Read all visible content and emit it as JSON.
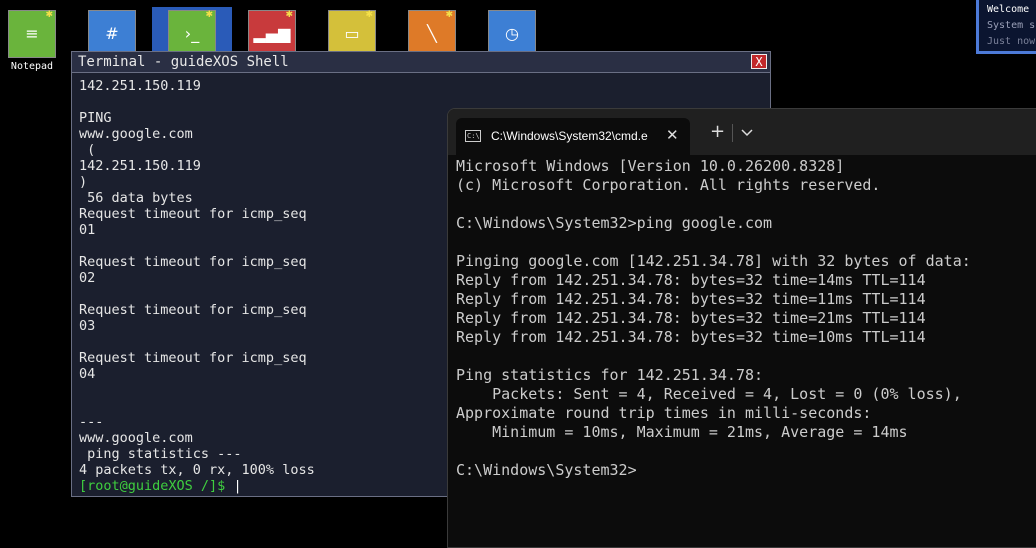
{
  "desktop": {
    "icons": [
      {
        "name": "notepad",
        "color": "#6ab43c",
        "glyph": "≡",
        "label": "Notepad"
      },
      {
        "name": "calculator",
        "color": "#3d7fd4",
        "glyph": "#",
        "label": ""
      },
      {
        "name": "terminal",
        "color": "#6ab43c",
        "glyph": "›_",
        "label": ""
      },
      {
        "name": "signal",
        "color": "#c83a3c",
        "glyph": "▂▄▆",
        "label": ""
      },
      {
        "name": "folder",
        "color": "#d4c03a",
        "glyph": "▭",
        "label": ""
      },
      {
        "name": "paint",
        "color": "#de7a28",
        "glyph": "╲",
        "label": ""
      },
      {
        "name": "clock",
        "color": "#3d7fd4",
        "glyph": "◷",
        "label": ""
      }
    ]
  },
  "notification": {
    "title": "Welcome",
    "message": "System s",
    "time": "Just now"
  },
  "guidexos_terminal": {
    "title": "Terminal - guideXOS Shell",
    "close_label": "X",
    "lines": [
      "142.251.150.119",
      "",
      "PING",
      "www.google.com",
      " (",
      "142.251.150.119",
      ")",
      " 56 data bytes",
      "Request timeout for icmp_seq",
      "01",
      "",
      "Request timeout for icmp_seq",
      "02",
      "",
      "Request timeout for icmp_seq",
      "03",
      "",
      "Request timeout for icmp_seq",
      "04",
      "",
      "",
      "---",
      "www.google.com",
      " ping statistics ---",
      "4 packets tx, 0 rx, 100% loss"
    ],
    "prompt": "[root@guideXOS /]$ ",
    "cursor": "|"
  },
  "windows_terminal": {
    "tab_title": "C:\\Windows\\System32\\cmd.e",
    "tab_close": "✕",
    "new_tab": "+",
    "lines": [
      "Microsoft Windows [Version 10.0.26200.8328]",
      "(c) Microsoft Corporation. All rights reserved.",
      "",
      "C:\\Windows\\System32>ping google.com",
      "",
      "Pinging google.com [142.251.34.78] with 32 bytes of data:",
      "Reply from 142.251.34.78: bytes=32 time=14ms TTL=114",
      "Reply from 142.251.34.78: bytes=32 time=11ms TTL=114",
      "Reply from 142.251.34.78: bytes=32 time=21ms TTL=114",
      "Reply from 142.251.34.78: bytes=32 time=10ms TTL=114",
      "",
      "Ping statistics for 142.251.34.78:",
      "    Packets: Sent = 4, Received = 4, Lost = 0 (0% loss),",
      "Approximate round trip times in milli-seconds:",
      "    Minimum = 10ms, Maximum = 21ms, Average = 14ms",
      "",
      "C:\\Windows\\System32>"
    ]
  }
}
